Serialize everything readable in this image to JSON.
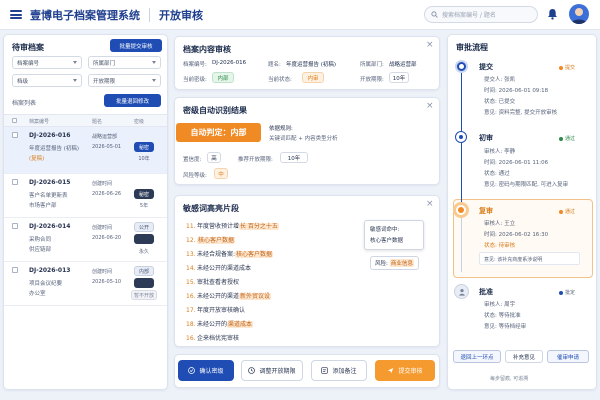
{
  "header": {
    "app_title": "壹博电子档案管理系统",
    "page_title": "开放审核",
    "search_placeholder": "搜索档案编号 / 题名"
  },
  "pending": {
    "title": "待审档案",
    "submit_batch_label": "批量提交审核",
    "filters": {
      "archive_no": "档案编号",
      "dept": "所属部门",
      "class": "档级",
      "period": "开放期限"
    },
    "list_title": "档案列表",
    "batch_modify_label": "批量退回修改",
    "columns": [
      "档案编号",
      "题名",
      "密级"
    ],
    "rows": [
      {
        "id": "DJ-2026-016",
        "line1": "年度运营报告 (初稿)",
        "line2": "(复稿)",
        "col_a": "战略运营部",
        "col_b": "2026-05-01",
        "tag": "秘密",
        "num": "10年"
      },
      {
        "id": "DJ-2026-015",
        "line1": "客户名单更新表",
        "line2": "市场客户部",
        "col_a": "创建时间",
        "col_b": "2026-06-26",
        "tag": "秘密",
        "num": "5年"
      },
      {
        "id": "DJ-2026-014",
        "line1": "采购合同",
        "line2": "供应链部",
        "col_a": "创建时间",
        "col_b": "2026-06-20",
        "tag": "公开",
        "num": "永久"
      },
      {
        "id": "DJ-2026-013",
        "line1": "项目会议纪要",
        "line2": "办公室",
        "col_a": "创建时间",
        "col_b": "2026-05-10",
        "tag": "内部",
        "num": "暂不开放"
      }
    ]
  },
  "content_review": {
    "title": "档案内容审核",
    "fields": [
      {
        "label": "档案编号:",
        "value": "DJ-2026-016"
      },
      {
        "label": "题名:",
        "value": "年度运营报告 (初稿)"
      },
      {
        "label": "所属部门:",
        "value": "战略运营部"
      },
      {
        "label": "当前密级:",
        "value": "内部"
      },
      {
        "label": "当前状态:",
        "value": "内审"
      },
      {
        "label": "开放期限:",
        "value": "10年"
      }
    ]
  },
  "ai_result": {
    "title": "密级自动识别结果",
    "badge": "自动判定：内部",
    "basis_label": "依据规则:",
    "basis_value": "关键词匹配 + 内容类型分析",
    "confidence_label": "置信度:",
    "confidence_value": "高",
    "period_label": "推荐开放期限:",
    "period_value": "10年",
    "risk_label": "风险等级:",
    "risk_value": "中"
  },
  "sensitive": {
    "title": "敏感词高亮片段",
    "lines": [
      {
        "n": "11.",
        "pre": "年度营收预计增",
        "hl": "长 百分之十五",
        "post": ""
      },
      {
        "n": "12.",
        "pre": "",
        "hl": "核心客户数据",
        "post": ""
      },
      {
        "n": "13.",
        "pre": "未经合规备案:",
        "hl": "核心客户数据",
        "post": ""
      },
      {
        "n": "14.",
        "pre": "未经公开的渠道成本",
        "hl": "",
        "post": ""
      },
      {
        "n": "15.",
        "pre": "审批查看者授权",
        "hl": "",
        "post": ""
      },
      {
        "n": "16.",
        "pre": "未经公开的渠道",
        "hl": "新外贸议设",
        "post": ""
      },
      {
        "n": "17.",
        "pre": "年度开放审核确认",
        "hl": "",
        "post": ""
      },
      {
        "n": "18.",
        "pre": "未经公开的",
        "hl": "渠道成本",
        "post": ""
      },
      {
        "n": "16.",
        "pre": "企来档优宪审核",
        "hl": "",
        "post": ""
      }
    ],
    "tooltip_title": "敏感词命中:",
    "tooltip_value": "核心客户数据",
    "risk_label": "风险:",
    "risk_value": "商业信息"
  },
  "actions": {
    "confirm": "确认密级",
    "adjust": "调整开放期限",
    "note": "添加备注",
    "submit": "提交审核"
  },
  "flow": {
    "title": "审批流程",
    "steps": [
      {
        "title": "提交",
        "tag": "提交",
        "lines": [
          "提交人: 张凯",
          "时间: 2026-06-01 09:18",
          "状态: 已提交",
          "意见: 资料完整, 提交开放审核"
        ]
      },
      {
        "title": "初审",
        "tag": "通过",
        "lines": [
          "审核人: 李静",
          "时间: 2026-06-01 11:06",
          "状态: 通过",
          "意见: 密码与期限匹配, 可进入复审"
        ]
      },
      {
        "title": "复审",
        "tag": "通过",
        "lines": [
          "审核人: 王立",
          "时间: 2026-06-02 16:30",
          "状态: 待审核"
        ],
        "note": "意见: 该补充商度系涉说明"
      },
      {
        "title": "批准",
        "tag": "批定",
        "lines": [
          "审核人: 周宇",
          "状态: 等待批准",
          "意见: 等待档经审"
        ]
      }
    ],
    "btn_prev": "退回上一环点",
    "btn_note": "补充意见",
    "btn_remind": "催审申请",
    "footer": "每步留痕, 可追溯"
  },
  "colors": {
    "brand": "#1f4db4",
    "accent": "#f08a24",
    "ok": "#2f8a4a"
  }
}
